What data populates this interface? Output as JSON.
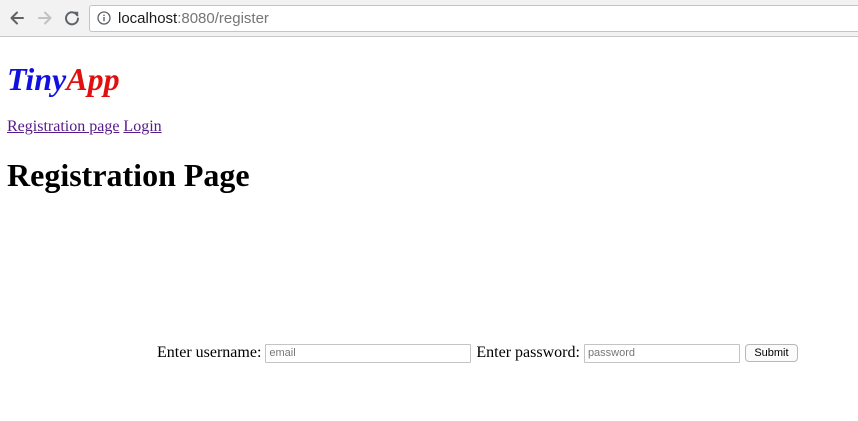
{
  "browser": {
    "url_host": "localhost",
    "url_rest": ":8080/register",
    "back_icon": "back-arrow-icon",
    "forward_icon": "forward-arrow-icon",
    "reload_icon": "reload-icon",
    "info_icon": "info-icon"
  },
  "logo": {
    "part1": "Tiny",
    "part2": "App",
    "part1_color": "#1010e0",
    "part2_color": "#e01010"
  },
  "nav": {
    "registration_label": "Registration page",
    "login_label": "Login",
    "link_color": "#551a8b"
  },
  "page_title": "Registration Page",
  "form": {
    "username_label": "Enter username:",
    "username_placeholder": "email",
    "username_value": "",
    "password_label": "Enter password:",
    "password_placeholder": "password",
    "password_value": "",
    "submit_label": "Submit"
  }
}
